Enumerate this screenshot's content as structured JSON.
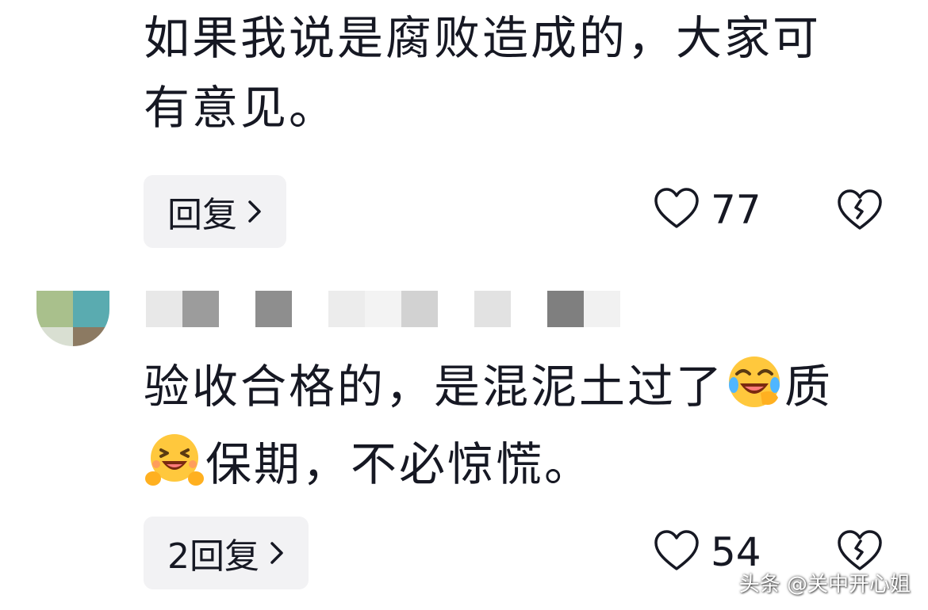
{
  "comments": [
    {
      "text_line1": "如果我说是腐败造成的，大家可",
      "text_line2": "有意见。",
      "reply_label": "回复",
      "likes": "77"
    },
    {
      "text_part1": "验收合格的，是混泥土过了",
      "text_part2": "质",
      "text_part3": "保期，不必惊慌。",
      "reply_label": "2回复",
      "likes": "54",
      "emojis": [
        "laughing-tears-emoji",
        "grinning-hands-emoji"
      ]
    }
  ],
  "watermark": "头条 @关中开心姐",
  "colors": {
    "text": "#161823",
    "reply_bg": "#f2f2f4",
    "icon_stroke": "#161823"
  }
}
